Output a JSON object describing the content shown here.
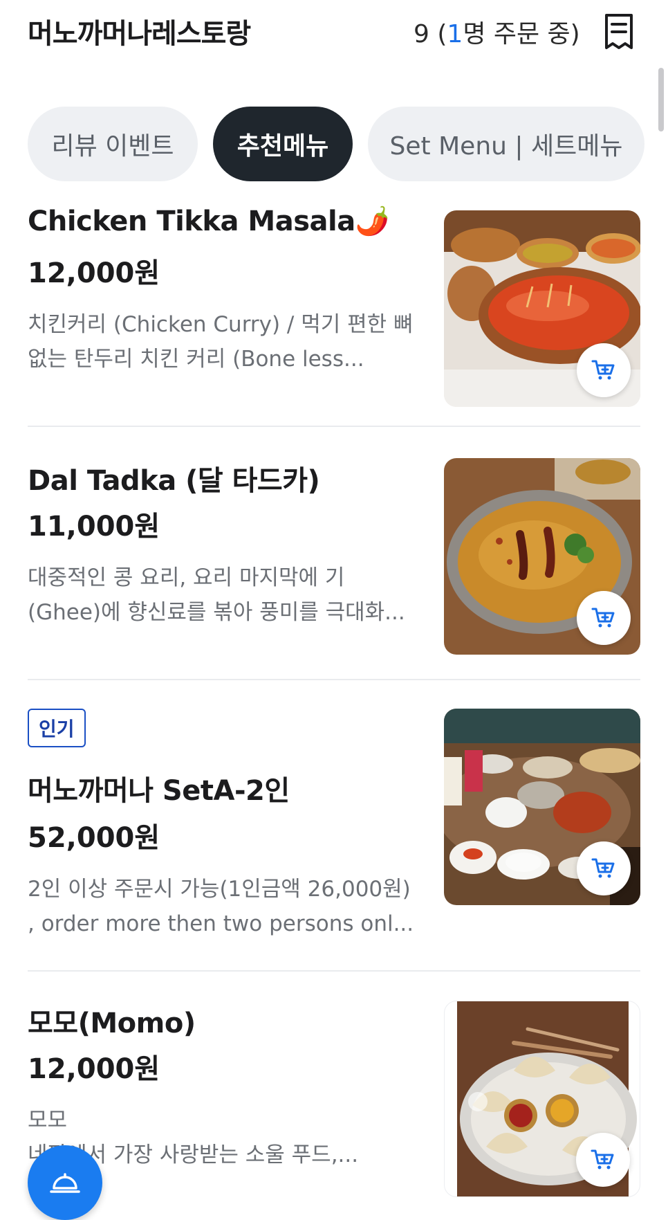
{
  "header": {
    "store_name": "머노까머나레스토랑",
    "order_count": "9",
    "order_open": " (",
    "order_highlight": "1",
    "order_suffix": "명 주문 중)",
    "receipt_icon": "receipt-icon"
  },
  "tabs": [
    {
      "label": "리뷰 이벤트",
      "active": false
    },
    {
      "label": "추천메뉴",
      "active": true
    },
    {
      "label": "Set Menu | 세트메뉴",
      "active": false
    }
  ],
  "menu_items": [
    {
      "title": "Chicken Tikka Masala🌶️",
      "price": "12,000원",
      "desc_line1": "치킨커리 (Chicken Curry) / 먹기 편한 뼈",
      "desc_line2": "없는 탄두리 치킨 커리 (Bone less...",
      "image": "chicken-curry-photo"
    },
    {
      "title": "Dal Tadka (달 타드카)",
      "price": "11,000원",
      "desc_line1": "대중적인 콩 요리, 요리 마지막에 기",
      "desc_line2": "(Ghee)에 향신료를 볶아 풍미를 극대화...",
      "image": "dal-tadka-photo"
    },
    {
      "badge": "인기",
      "title": "머노까머나 SetA-2인",
      "price": "52,000원",
      "desc_line1": "2인 이상 주문시 가능(1인금액 26,000원)",
      "desc_line2": ", order more then two persons onl...",
      "image": "set-a-photo"
    },
    {
      "title": "모모(Momo)",
      "price": "12,000원",
      "desc_line1": "모모",
      "desc_line2": "네팔에서 가장 사랑받는 소울 푸드,...",
      "image": "momo-photo"
    }
  ],
  "colors": {
    "accent": "#1a7cf0",
    "active_tab": "#1f262d",
    "badge": "#1a4fc4"
  },
  "fab_icon": "service-bell-icon"
}
